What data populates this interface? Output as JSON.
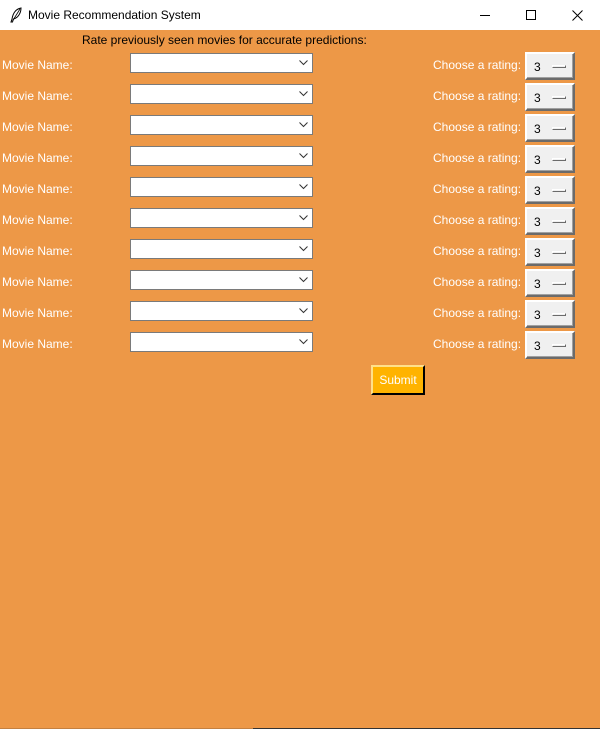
{
  "window": {
    "title": "Movie Recommendation System",
    "app_icon": "feather-icon",
    "controls": [
      "minimize-icon",
      "maximize-icon",
      "close-icon"
    ]
  },
  "colors": {
    "background": "#ED9847",
    "label_text": "#ffffff",
    "submit_background": "#FFB300"
  },
  "heading": "Rate previously seen movies for accurate predictions:",
  "rows": [
    {
      "movie_label": "Movie Name:",
      "movie_value": "",
      "rating_label": "Choose a rating:",
      "rating_value": "3"
    },
    {
      "movie_label": "Movie Name:",
      "movie_value": "",
      "rating_label": "Choose a rating:",
      "rating_value": "3"
    },
    {
      "movie_label": "Movie Name:",
      "movie_value": "",
      "rating_label": "Choose a rating:",
      "rating_value": "3"
    },
    {
      "movie_label": "Movie Name:",
      "movie_value": "",
      "rating_label": "Choose a rating:",
      "rating_value": "3"
    },
    {
      "movie_label": "Movie Name:",
      "movie_value": "",
      "rating_label": "Choose a rating:",
      "rating_value": "3"
    },
    {
      "movie_label": "Movie Name:",
      "movie_value": "",
      "rating_label": "Choose a rating:",
      "rating_value": "3"
    },
    {
      "movie_label": "Movie Name:",
      "movie_value": "",
      "rating_label": "Choose a rating:",
      "rating_value": "3"
    },
    {
      "movie_label": "Movie Name:",
      "movie_value": "",
      "rating_label": "Choose a rating:",
      "rating_value": "3"
    },
    {
      "movie_label": "Movie Name:",
      "movie_value": "",
      "rating_label": "Choose a rating:",
      "rating_value": "3"
    },
    {
      "movie_label": "Movie Name:",
      "movie_value": "",
      "rating_label": "Choose a rating:",
      "rating_value": "3"
    }
  ],
  "submit_label": "Submit"
}
